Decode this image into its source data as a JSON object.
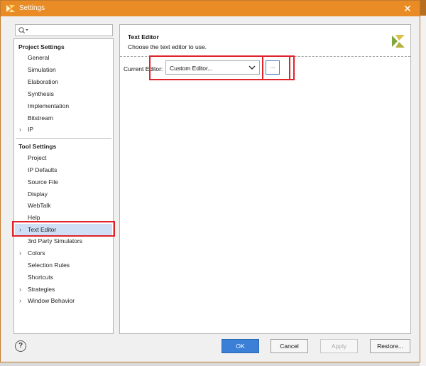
{
  "window": {
    "title": "Settings",
    "close_glyph": "✕",
    "icon": "vivado-logo-icon"
  },
  "search": {
    "placeholder": "",
    "icon": "search-icon"
  },
  "sidebar": {
    "project_settings": {
      "header": "Project Settings",
      "items": [
        {
          "label": "General",
          "chevron": ""
        },
        {
          "label": "Simulation",
          "chevron": ""
        },
        {
          "label": "Elaboration",
          "chevron": ""
        },
        {
          "label": "Synthesis",
          "chevron": ""
        },
        {
          "label": "Implementation",
          "chevron": ""
        },
        {
          "label": "Bitstream",
          "chevron": ""
        },
        {
          "label": "IP",
          "chevron": "›"
        }
      ]
    },
    "tool_settings": {
      "header": "Tool Settings",
      "items": [
        {
          "label": "Project",
          "chevron": ""
        },
        {
          "label": "IP Defaults",
          "chevron": ""
        },
        {
          "label": "Source File",
          "chevron": ""
        },
        {
          "label": "Display",
          "chevron": ""
        },
        {
          "label": "WebTalk",
          "chevron": ""
        },
        {
          "label": "Help",
          "chevron": ""
        },
        {
          "label": "Text Editor",
          "chevron": "›",
          "selected": true
        },
        {
          "label": "3rd Party Simulators",
          "chevron": ""
        },
        {
          "label": "Colors",
          "chevron": "›"
        },
        {
          "label": "Selection Rules",
          "chevron": ""
        },
        {
          "label": "Shortcuts",
          "chevron": ""
        },
        {
          "label": "Strategies",
          "chevron": "›"
        },
        {
          "label": "Window Behavior",
          "chevron": "›"
        }
      ]
    }
  },
  "main": {
    "title": "Text Editor",
    "description": "Choose the text editor to use.",
    "current_editor_label": "Current Editor:",
    "current_editor_value": "Custom Editor...",
    "browse_label": "...",
    "logo_icon": "xilinx-logo-icon"
  },
  "buttons": {
    "help": "?",
    "ok": "OK",
    "cancel": "Cancel",
    "apply": "Apply",
    "restore": "Restore..."
  },
  "colors": {
    "titlebar": "#e98c26",
    "selection": "#cfe0f6",
    "highlight_box": "#e0222a",
    "ok_button": "#3b7fd6"
  }
}
